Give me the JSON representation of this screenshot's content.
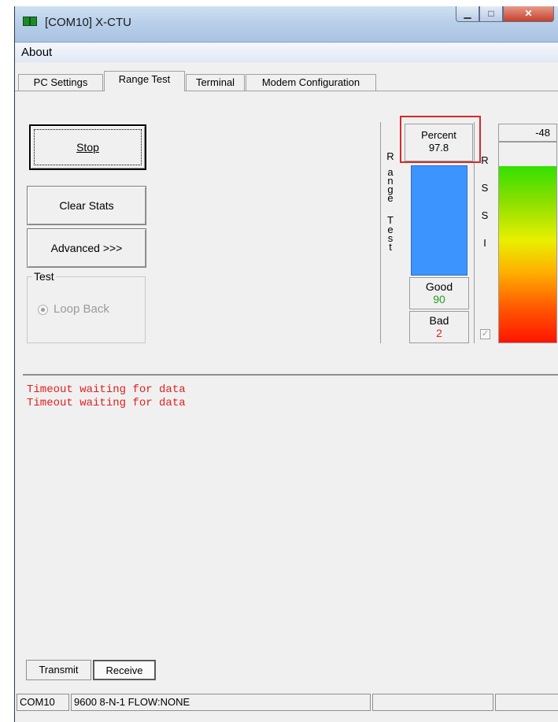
{
  "window": {
    "title": "[COM10] X-CTU"
  },
  "menu": {
    "about": "About"
  },
  "tabs": [
    {
      "label": "PC Settings"
    },
    {
      "label": "Range Test"
    },
    {
      "label": "Terminal"
    },
    {
      "label": "Modem Configuration"
    }
  ],
  "controls": {
    "stop_label": "Stop",
    "clear_stats_label": "Clear Stats",
    "advanced_label": "Advanced >>>",
    "test_group_title": "Test",
    "loop_back_label": "Loop Back"
  },
  "range_test": {
    "vertical_label": "Range Test",
    "percent_label": "Percent",
    "percent_value": "97.8",
    "good_label": "Good",
    "good_value": "90",
    "bad_label": "Bad",
    "bad_value": "2",
    "good_color": "#20a020",
    "bad_color": "#e02020",
    "bar_color": "#3c94ff"
  },
  "rssi": {
    "vertical_label": "RSSI",
    "value": "-48",
    "enabled_checked": true
  },
  "log": {
    "lines": [
      "Timeout waiting for data",
      "Timeout waiting for data"
    ],
    "text_color": "#e02020"
  },
  "bottom_tabs": [
    {
      "label": "Transmit"
    },
    {
      "label": "Receive"
    }
  ],
  "status": {
    "port": "COM10",
    "settings": "9600 8-N-1  FLOW:NONE",
    "cell3": "",
    "cell4": "",
    "cell5": ""
  }
}
